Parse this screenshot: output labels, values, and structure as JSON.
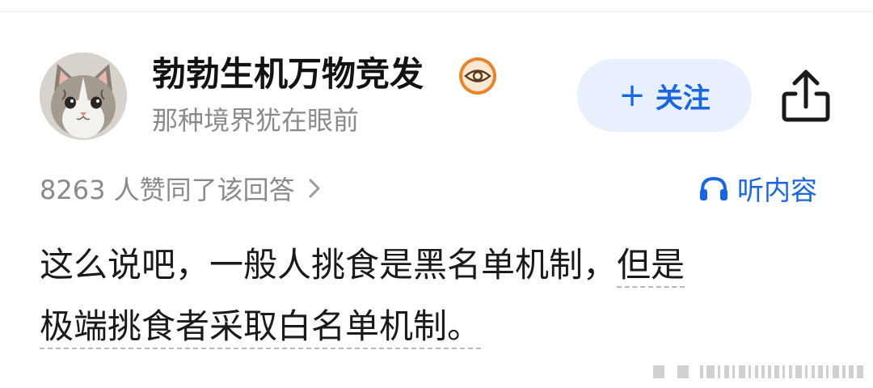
{
  "author": {
    "name": "勃勃生机万物竞发",
    "bio": "那种境界犹在眼前",
    "avatar_icon": "cat-avatar",
    "badge_icon": "eye-badge-icon"
  },
  "actions": {
    "follow_plus": "+",
    "follow_label": "关注",
    "share_icon": "share-icon"
  },
  "stats": {
    "likes_text": "8263 人赞同了该回答"
  },
  "listen": {
    "label": "听内容",
    "icon": "headphones-icon"
  },
  "answer": {
    "part1": "这么说吧，一般人挑食是黑名单机制，",
    "part2": "但是",
    "part3": "极端挑食者采取白名单机制。"
  },
  "colors": {
    "accent": "#1a66e0",
    "follow_bg": "#e8f0fd",
    "muted_text": "#8a8a8a",
    "badge": "#e8842c"
  }
}
